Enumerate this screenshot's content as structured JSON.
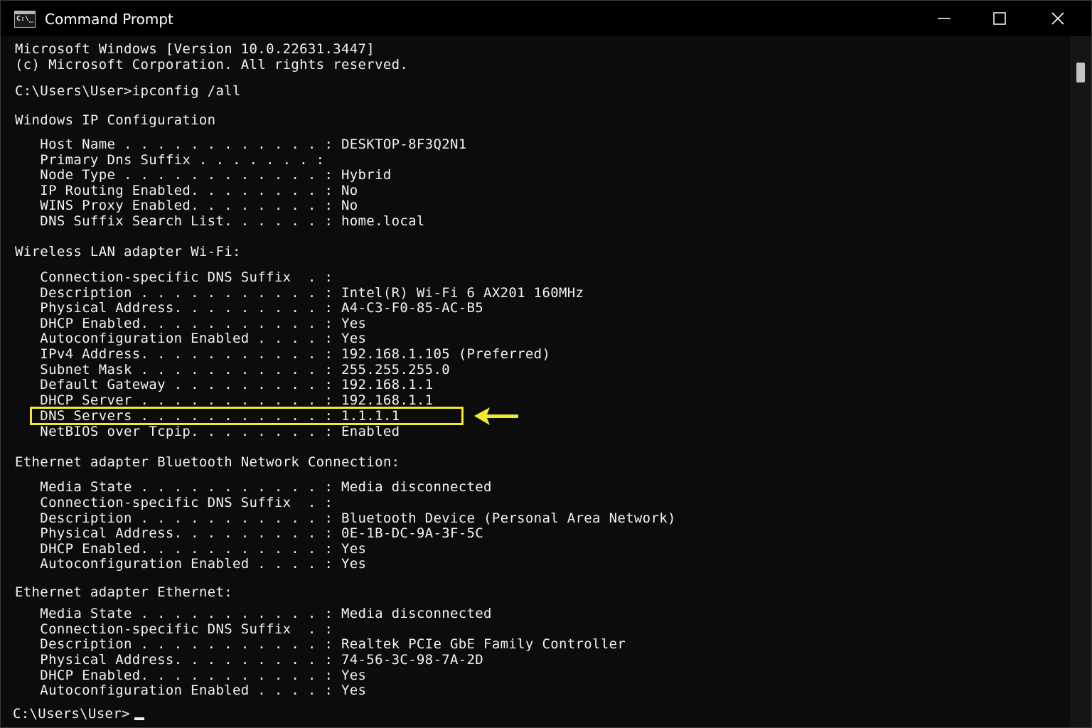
{
  "window": {
    "title": "Command Prompt",
    "icon": "cmd-icon",
    "icon_text": "C:\\_"
  },
  "controls": {
    "minimize": "minimize-icon",
    "maximize": "maximize-icon",
    "close": "close-icon"
  },
  "console": {
    "lines": [
      "Microsoft Windows [Version 10.0.22631.3447]",
      "(c) Microsoft Corporation. All rights reserved.",
      "C:\\Users\\User>ipconfig /all",
      "Windows IP Configuration",
      "   Host Name . . . . . . . . . . . . : DESKTOP-8F3Q2N1",
      "   Primary Dns Suffix . . . . . . . :",
      "   Node Type . . . . . . . . . . . . : Hybrid",
      "   IP Routing Enabled. . . . . . . . : No",
      "   WINS Proxy Enabled. . . . . . . . : No",
      "   DNS Suffix Search List. . . . . . : home.local",
      "Wireless LAN adapter Wi-Fi:",
      "   Connection-specific DNS Suffix  . :",
      "   Description . . . . . . . . . . . : Intel(R) Wi-Fi 6 AX201 160MHz",
      "   Physical Address. . . . . . . . . : A4-C3-F0-85-AC-B5",
      "   DHCP Enabled. . . . . . . . . . . : Yes",
      "   Autoconfiguration Enabled . . . . : Yes",
      "   IPv4 Address. . . . . . . . . . . : 192.168.1.105 (Preferred)",
      "   Subnet Mask . . . . . . . . . . . : 255.255.255.0",
      "   Default Gateway . . . . . . . . . : 192.168.1.1",
      "   DHCP Server . . . . . . . . . . . : 192.168.1.1",
      "   DNS Servers . . . . . . . . . . . : 1.1.1.1",
      "   NetBIOS over Tcpip. . . . . . . . : Enabled",
      "Ethernet adapter Bluetooth Network Connection:",
      "   Media State . . . . . . . . . . . : Media disconnected",
      "   Connection-specific DNS Suffix  . :",
      "   Description . . . . . . . . . . . : Bluetooth Device (Personal Area Network)",
      "   Physical Address. . . . . . . . . : 0E-1B-DC-9A-3F-5C",
      "   DHCP Enabled. . . . . . . . . . . : Yes",
      "   Autoconfiguration Enabled . . . . : Yes",
      "Ethernet adapter Ethernet:",
      "   Media State . . . . . . . . . . . : Media disconnected",
      "   Connection-specific DNS Suffix  . :",
      "   Description . . . . . . . . . . . : Realtek PCIe GbE Family Controller",
      "   Physical Address. . . . . . . . . : 74-56-3C-98-7A-2D",
      "   DHCP Enabled. . . . . . . . . . . : Yes",
      "   Autoconfiguration Enabled . . . . : Yes",
      "C:\\Users\\User>"
    ]
  },
  "annotation": {
    "highlight_color": "#f2ea2e",
    "arrow_icon": "arrow-left-icon"
  },
  "colors": {
    "background": "#0c0c0c",
    "text": "#f2f2f2",
    "titlebar": "#000000"
  }
}
